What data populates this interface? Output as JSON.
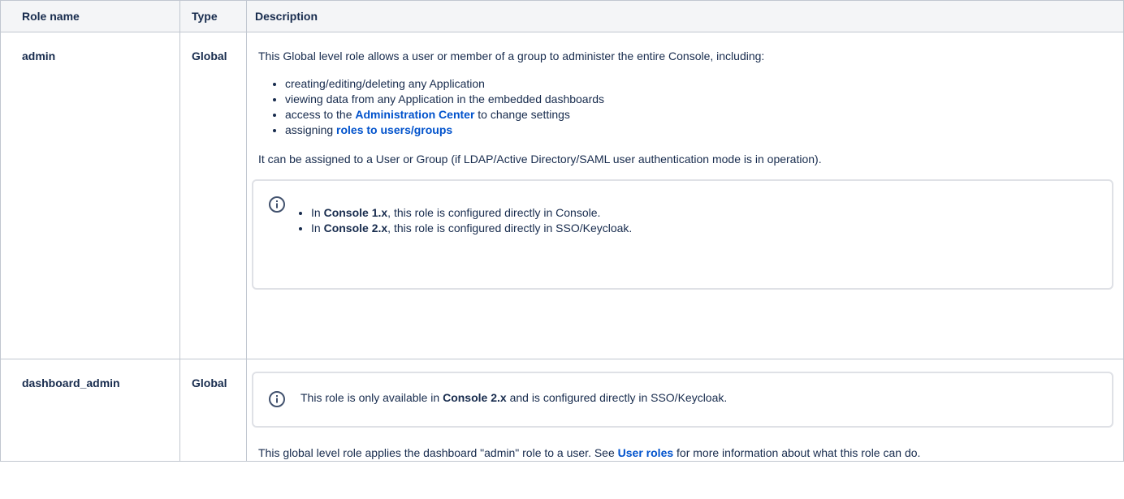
{
  "headers": {
    "name": "Role name",
    "type": "Type",
    "description": "Description"
  },
  "icons": {
    "info": "info-circle-icon"
  },
  "colors": {
    "link": "#0052cc",
    "header_bg": "#f4f5f7",
    "border": "#c1c7d0"
  },
  "rows": [
    {
      "name": "admin",
      "type": "Global",
      "intro": "This Global level role allows a user or member of a group to administer the entire Console, including:",
      "bullets": [
        {
          "text": "creating/editing/deleting any Application"
        },
        {
          "text": "viewing data from any Application in the embedded dashboards"
        },
        {
          "before": "access to the ",
          "link": "Administration Center",
          "after": " to change settings"
        },
        {
          "before": "assigning ",
          "link": "roles to users/groups"
        }
      ],
      "assign_text": "It can be assigned to a User or Group (if LDAP/Active Directory/SAML user authentication mode is in operation).",
      "info_items": [
        {
          "prefix": "In ",
          "bold": "Console 1.x",
          "suffix": ", this role is configured directly in Console."
        },
        {
          "prefix": "In ",
          "bold": "Console  2.x",
          "suffix": ", this role is configured directly in SSO/Keycloak."
        }
      ]
    },
    {
      "name": "dashboard_admin",
      "type": "Global",
      "info": {
        "prefix": "This role is only available in ",
        "bold": "Console  2.x",
        "suffix": " and is configured directly in SSO/Keycloak."
      },
      "note_before": "This global level role applies the dashboard \"admin\" role to a user. See ",
      "note_link": "User roles",
      "note_after": " for more information about what this role can do."
    }
  ]
}
